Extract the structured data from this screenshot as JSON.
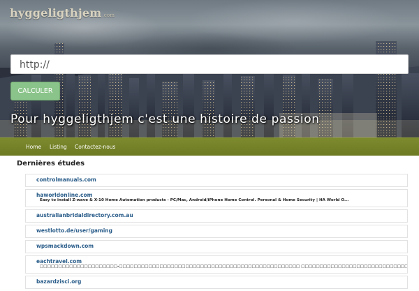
{
  "header": {
    "logo_text": "hyggeligthjem",
    "logo_suffix": ".com",
    "search": {
      "value": "http://",
      "placeholder": ""
    },
    "calculate_label": "CALCULER",
    "tagline": "Pour hyggeligthjem c'est une histoire de passion"
  },
  "nav": {
    "items": [
      {
        "label": "Home"
      },
      {
        "label": "Listing"
      },
      {
        "label": "Contactez-nous"
      }
    ]
  },
  "main": {
    "section_title": "Dernières études",
    "entries": [
      {
        "site": "controlmanuals.com",
        "desc": ""
      },
      {
        "site": "haworldonline.com",
        "desc": "Easy to install Z-wave & X-10 Home Automation products - PC/Mac, Android/iPhone Home Control. Personal & Home Security | HA World O..."
      },
      {
        "site": "australianbridaldirectory.com.au",
        "desc": ""
      },
      {
        "site": "westlotto.de/user/gaming",
        "desc": ""
      },
      {
        "site": "wpsmackdown.com",
        "desc": ""
      },
      {
        "site": "eachtravel.com",
        "desc": "□□□□□□□□□□□□□□□□□□□□□-□□□□□□□□□□□□□□□□□□□□□□□□□□□□□□□□□□□□□□□□□□□□□□□□□ □□□□□□□□□□□□□□□□□□□□□□□□□□□□□□□□□□□□□□□□□□□□□□□□□□"
      },
      {
        "site": "bazardzisci.org",
        "desc": ""
      }
    ]
  },
  "colors": {
    "nav_bg": "#74812a",
    "button_bg": "#8bc48a",
    "link": "#2a5d8a"
  }
}
